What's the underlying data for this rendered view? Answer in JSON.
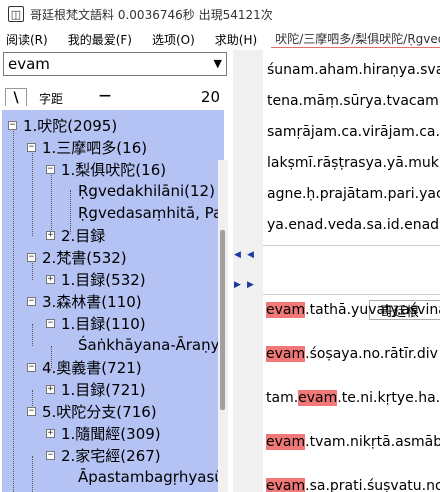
{
  "window": {
    "app_title": "哥廷根梵文語料",
    "time": "0.0036746秒",
    "hits": "出現54121次"
  },
  "menu": {
    "items": [
      "阅读(R)",
      "我的最爱(F)",
      "选项(O)",
      "求助(H)"
    ],
    "path": "吠陀/三摩呬多/梨俱吠陀/Ṛgvedakh"
  },
  "search": {
    "value": "evam"
  },
  "sort": {
    "button": "\\",
    "label": "字距",
    "dash": "—",
    "count": "20"
  },
  "tree": [
    {
      "exp": "−",
      "label": "1.吠陀(2095)"
    },
    {
      "exp": "−",
      "label": "1.三摩呬多(16)"
    },
    {
      "exp": "−",
      "label": "1.梨俱吠陀(16)"
    },
    {
      "exp": "",
      "label": "Ṛgvedakhilāni(12)"
    },
    {
      "exp": "",
      "label": "Ṛgvedasaṃhitā, Pa"
    },
    {
      "exp": "+",
      "label": "2.目録"
    },
    {
      "exp": "−",
      "label": "2.梵書(532)"
    },
    {
      "exp": "+",
      "label": "1.目録(532)"
    },
    {
      "exp": "−",
      "label": "3.森林書(110)"
    },
    {
      "exp": "−",
      "label": "1.目録(110)"
    },
    {
      "exp": "",
      "label": "Śaṅkhāyana-Āraṇy"
    },
    {
      "exp": "−",
      "label": "4.奧義書(721)"
    },
    {
      "exp": "+",
      "label": "1.目録(721)"
    },
    {
      "exp": "−",
      "label": "5.吠陀分支(716)"
    },
    {
      "exp": "+",
      "label": "1.隨聞經(309)"
    },
    {
      "exp": "−",
      "label": "2.家宅經(267)"
    },
    {
      "exp": "",
      "label": "Āpastambagṛhyasū"
    }
  ],
  "top_text": [
    "śunam.aham.hiraṇya.sva",
    "tena.māṃ.sūrya.tvacam.",
    "samṛājam.ca.virājam.ca.",
    "lakṣmī.rāṣṭrasya.yā.mukh",
    "agne.ḥ.prajātam.pari.yac",
    "ya.enad.veda.sa.id.enad."
  ],
  "doc_header": "哥廷根",
  "results": [
    {
      "pre": "",
      "hit": "evam",
      "post": ".tathā.yuvaty.aśvina"
    },
    {
      "pre": "",
      "hit": "evam",
      "post": ".śoṣaya.no.rātīr.div"
    },
    {
      "pre": "tam.",
      "hit": "evam",
      "post": ".te.ni.kṛtye.ha."
    },
    {
      "pre": "",
      "hit": "evam",
      "post": ".tvam.nikṛtā.asmāb"
    },
    {
      "pre": "",
      "hit": "evam",
      "post": ".sa.prati.śuṣvatu.no"
    }
  ],
  "colors": {
    "tree_bg": "#b4c3f4",
    "highlight": "#f07878"
  }
}
